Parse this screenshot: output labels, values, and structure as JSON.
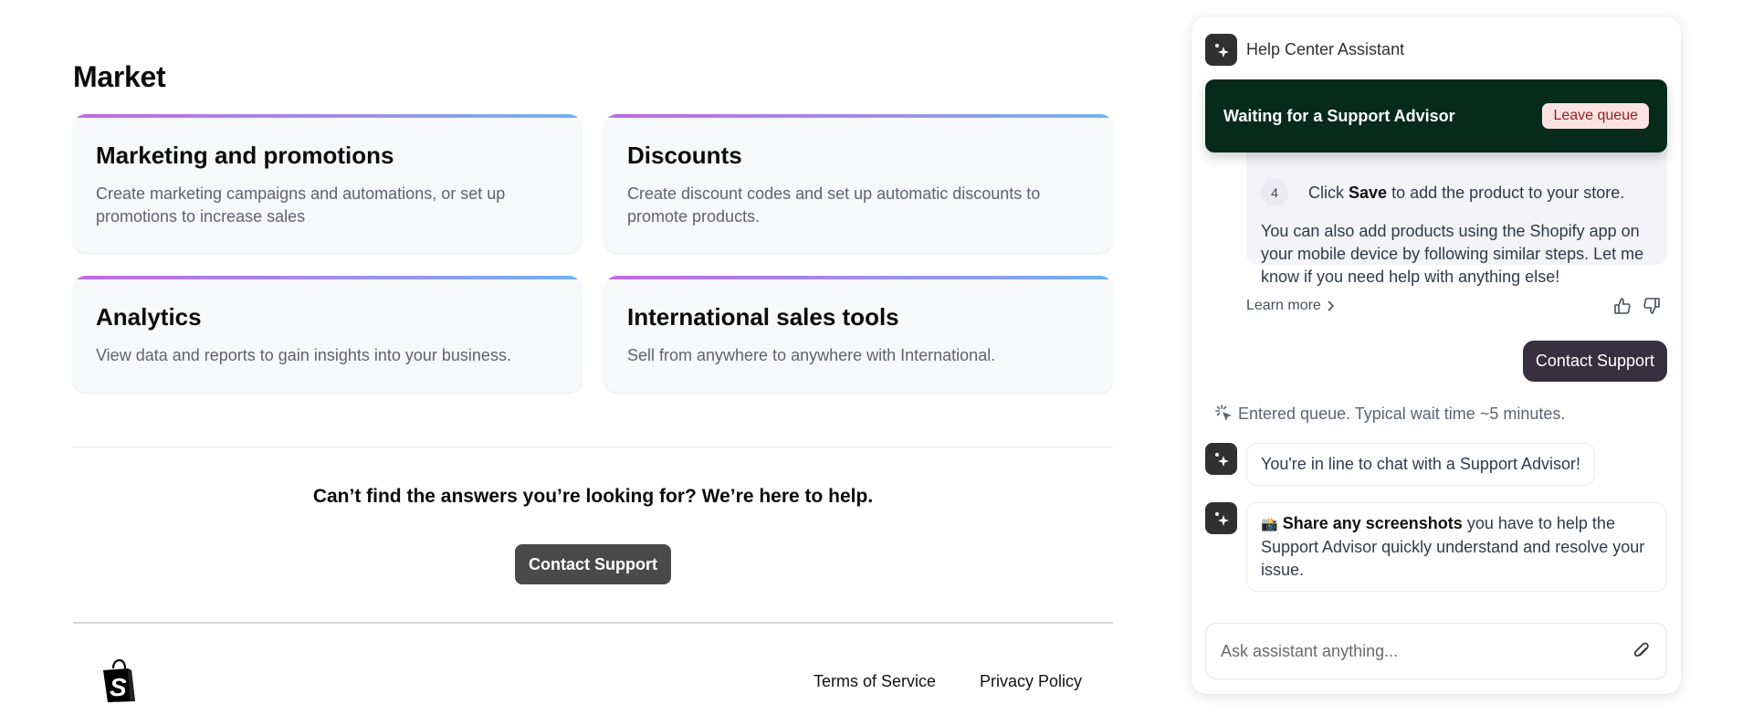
{
  "main": {
    "title": "Market",
    "cards": [
      {
        "title": "Marketing and promotions",
        "description": "Create marketing campaigns and automations, or set up promotions to increase sales"
      },
      {
        "title": "Discounts",
        "description": "Create discount codes and set up automatic discounts to promote products."
      },
      {
        "title": "Analytics",
        "description": "View data and reports to gain insights into your business."
      },
      {
        "title": "International sales tools",
        "description": "Sell from anywhere to anywhere with International."
      }
    ],
    "help_text": "Can’t find the answers you’re looking for? We’re here to help.",
    "contact_button": "Contact Support"
  },
  "footer": {
    "logo": "shopify-bag-icon",
    "links": [
      "Terms of Service",
      "Privacy Policy"
    ]
  },
  "chat": {
    "title": "Help Center Assistant",
    "banner": {
      "text": "Waiting for a Support Advisor",
      "button": "Leave queue",
      "color": "#062b1c"
    },
    "answer": {
      "step_number": "4",
      "step_prefix": "Click",
      "step_bold": "Save",
      "step_suffix": "to add the product to your store.",
      "paragraph": "You can also add products using the Shopify app on your mobile device by following similar steps. Let me know if you need help with anything else!"
    },
    "learn_more": "Learn more",
    "user_message": "Contact Support",
    "system_message": "Entered queue. Typical wait time ~5 minutes.",
    "bot_messages": [
      {
        "text": "You're in line to chat with a Support Advisor!"
      },
      {
        "emoji": "📸",
        "bold": "Share any screenshots",
        "text": "you have to help the Support Advisor quickly understand and resolve your issue."
      }
    ],
    "input_placeholder": "Ask assistant anything..."
  }
}
